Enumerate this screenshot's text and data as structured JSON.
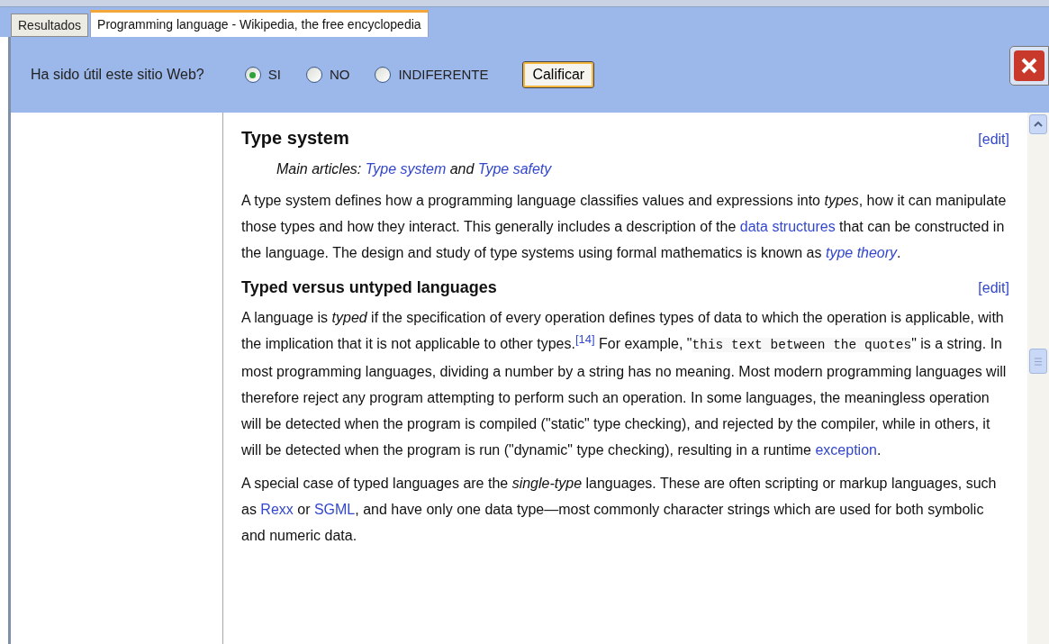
{
  "tabs": [
    {
      "label": "Resultados",
      "selected": false
    },
    {
      "label": "Programming language - Wikipedia, the free encyclopedia",
      "selected": true
    }
  ],
  "rating": {
    "question": "Ha sido útil este sitio Web?",
    "options": [
      {
        "label": "SI",
        "selected": true
      },
      {
        "label": "NO",
        "selected": false
      },
      {
        "label": "INDIFERENTE",
        "selected": false
      }
    ],
    "button": "Calificar"
  },
  "article": {
    "sections": [
      {
        "heading": "Type system",
        "kind": "section",
        "edit": "[edit]",
        "blocks": [
          {
            "kind": "hatnote",
            "segments": [
              {
                "kind": "text",
                "text": "Main articles: "
              },
              {
                "kind": "link",
                "text": "Type system"
              },
              {
                "kind": "text",
                "text": " and "
              },
              {
                "kind": "link",
                "text": "Type safety"
              }
            ]
          },
          {
            "kind": "paragraph",
            "segments": [
              {
                "kind": "text",
                "text": "A type system defines how a programming language classifies values and expressions into *types*, how it can manipulate those types and how they interact. This generally includes a description of the "
              },
              {
                "kind": "link",
                "text": "data structures"
              },
              {
                "kind": "text",
                "text": " that can be constructed in the language. The design and study of type systems using formal mathematics is known as "
              },
              {
                "kind": "link",
                "text": "*type theory*"
              },
              {
                "kind": "text",
                "text": "."
              }
            ]
          }
        ]
      },
      {
        "heading": "Typed versus untyped languages",
        "kind": "subsection",
        "edit": "[edit]",
        "blocks": [
          {
            "kind": "paragraph",
            "segments": [
              {
                "kind": "text",
                "text": "A language is *typed* if the specification of every operation defines types of data to which the operation is applicable, with the implication that it is not applicable to other types."
              },
              {
                "kind": "ref",
                "text": "[14]"
              },
              {
                "kind": "text",
                "text": " For example, \""
              },
              {
                "kind": "code",
                "text": "this text between the quotes"
              },
              {
                "kind": "text",
                "text": "\" is a string. In most programming languages, dividing a number by a string has no meaning. Most modern programming languages will therefore reject any program attempting to perform such an operation. In some languages, the meaningless operation will be detected when the program is compiled (\"static\" type checking), and rejected by the compiler, while in others, it will be detected when the program is run (\"dynamic\" type checking), resulting in a runtime "
              },
              {
                "kind": "link",
                "text": "exception"
              },
              {
                "kind": "text",
                "text": "."
              }
            ]
          },
          {
            "kind": "paragraph",
            "segments": [
              {
                "kind": "text",
                "text": "A special case of typed languages are the *single-type* languages. These are often scripting or markup languages, such as "
              },
              {
                "kind": "link",
                "text": "Rexx"
              },
              {
                "kind": "text",
                "text": " or "
              },
              {
                "kind": "link",
                "text": "SGML"
              },
              {
                "kind": "text",
                "text": ", and have only one data type—most commonly character strings which are used for both symbolic and numeric data."
              }
            ]
          }
        ]
      }
    ]
  }
}
